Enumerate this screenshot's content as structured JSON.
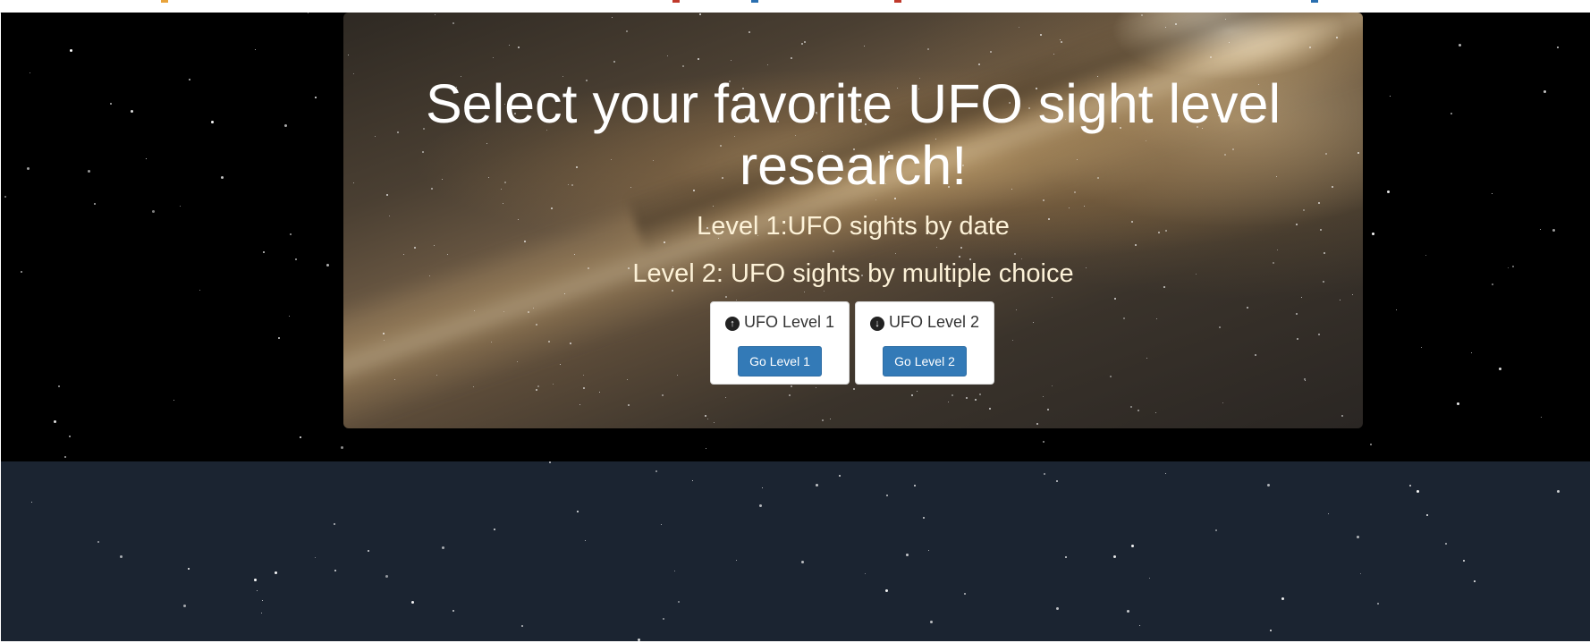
{
  "hero": {
    "headline": "Select your favorite UFO sight level research!",
    "level1_text": "Level 1:UFO sights by date",
    "level2_text": "Level 2: UFO sights by multiple choice"
  },
  "cards": [
    {
      "title": "UFO Level 1",
      "icon": "circle-arrow-up-icon",
      "button_label": "Go Level 1"
    },
    {
      "title": "UFO Level 2",
      "icon": "circle-arrow-down-icon",
      "button_label": "Go Level 2"
    }
  ],
  "colors": {
    "button": "#337ab7",
    "level_text": "#fdf2d8",
    "space_top": "#000000",
    "space_bottom": "#1b2431"
  }
}
